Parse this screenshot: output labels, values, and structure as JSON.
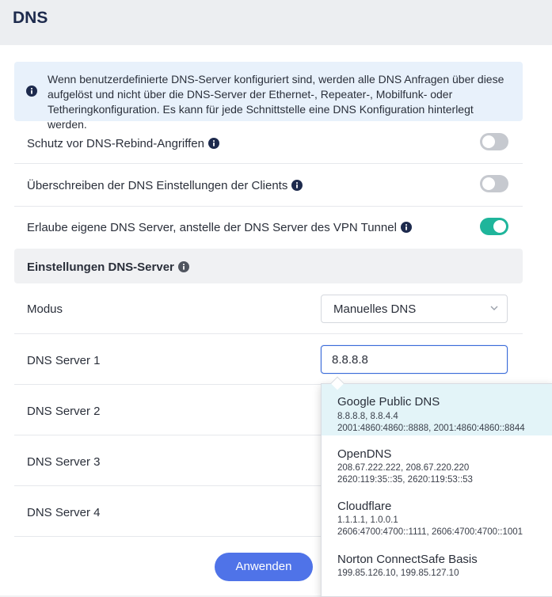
{
  "header": {
    "title": "DNS"
  },
  "info": {
    "text": "Wenn benutzerdefinierte DNS-Server konfiguriert sind, werden alle DNS Anfragen über diese aufgelöst und nicht über die DNS-Server der Ethernet-, Repeater-, Mobilfunk- oder Tetheringkonfiguration. Es kann für jede Schnittstelle eine DNS Konfiguration hinterlegt werden."
  },
  "toggles": [
    {
      "label": "Schutz vor DNS-Rebind-Angriffen",
      "on": false
    },
    {
      "label": "Überschreiben der DNS Einstellungen der Clients",
      "on": false
    },
    {
      "label": "Erlaube eigene DNS Server, anstelle der DNS Server des VPN Tunnel",
      "on": true
    }
  ],
  "section": {
    "title": "Einstellungen DNS-Server"
  },
  "mode": {
    "label": "Modus",
    "value": "Manuelles DNS"
  },
  "servers": [
    {
      "label": "DNS Server 1",
      "value": "8.8.8.8"
    },
    {
      "label": "DNS Server 2",
      "value": ""
    },
    {
      "label": "DNS Server 3",
      "value": ""
    },
    {
      "label": "DNS Server 4",
      "value": ""
    }
  ],
  "dropdown": {
    "options": [
      {
        "name": "Google Public DNS",
        "ipv4": "8.8.8.8, 8.8.4.4",
        "ipv6": "2001:4860:4860::8888, 2001:4860:4860::8844",
        "highlighted": true
      },
      {
        "name": "OpenDNS",
        "ipv4": "208.67.222.222, 208.67.220.220",
        "ipv6": "2620:119:35::35, 2620:119:53::53",
        "highlighted": false
      },
      {
        "name": "Cloudflare",
        "ipv4": "1.1.1.1, 1.0.0.1",
        "ipv6": "2606:4700:4700::1111, 2606:4700:4700::1001",
        "highlighted": false
      },
      {
        "name": "Norton ConnectSafe Basis",
        "ipv4": "199.85.126.10, 199.85.127.10",
        "ipv6": "",
        "highlighted": false
      }
    ]
  },
  "buttons": {
    "apply": "Anwenden"
  },
  "colors": {
    "accent": "#4f73e8",
    "toggle_on": "#1fb59b",
    "toggle_off": "#c6c9cf",
    "info_bg": "#e8f1fb",
    "highlight": "#e3f4f8"
  }
}
